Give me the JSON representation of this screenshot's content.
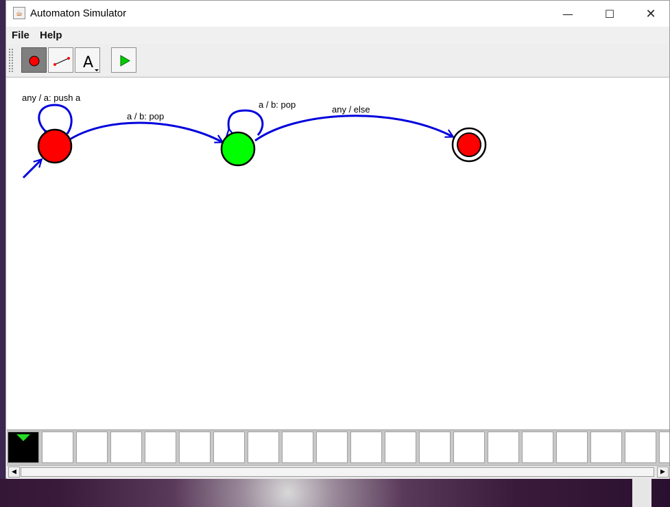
{
  "window": {
    "title": "Automaton Simulator",
    "controls": {
      "minimize": "—",
      "maximize": "☐",
      "close": "✕"
    }
  },
  "menu": {
    "items": [
      "File",
      "Help"
    ]
  },
  "toolbar": {
    "tools": [
      {
        "name": "add-state-tool",
        "icon": "state-circle-icon",
        "selected": true
      },
      {
        "name": "add-transition-tool",
        "icon": "transition-line-icon",
        "selected": false
      },
      {
        "name": "text-tool",
        "icon": "text-a-icon",
        "label": "A",
        "selected": false
      },
      {
        "name": "run-tool",
        "icon": "play-icon",
        "selected": false
      }
    ]
  },
  "automaton": {
    "states": [
      {
        "id": "s0",
        "color": "#ff0000",
        "initial": true,
        "accepting": false
      },
      {
        "id": "s1",
        "color": "#00ff00",
        "initial": false,
        "accepting": false
      },
      {
        "id": "s2",
        "color": "#ff0000",
        "initial": false,
        "accepting": true
      }
    ],
    "transitions": [
      {
        "from": "s0",
        "to": "s0",
        "label": "any / a: push a"
      },
      {
        "from": "s0",
        "to": "s1",
        "label": "a / b: pop"
      },
      {
        "from": "s1",
        "to": "s1",
        "label": "a / b: pop"
      },
      {
        "from": "s1",
        "to": "s2",
        "label": "any / else"
      }
    ],
    "edge_color": "#0000dd"
  },
  "tape": {
    "cells": [
      "",
      "",
      "",
      "",
      "",
      "",
      "",
      "",
      "",
      "",
      "",
      "",
      "",
      "",
      "",
      "",
      "",
      "",
      "",
      ""
    ],
    "head_index": 0
  },
  "scrollbar": {
    "left_arrow": "◀",
    "right_arrow": "▶"
  }
}
